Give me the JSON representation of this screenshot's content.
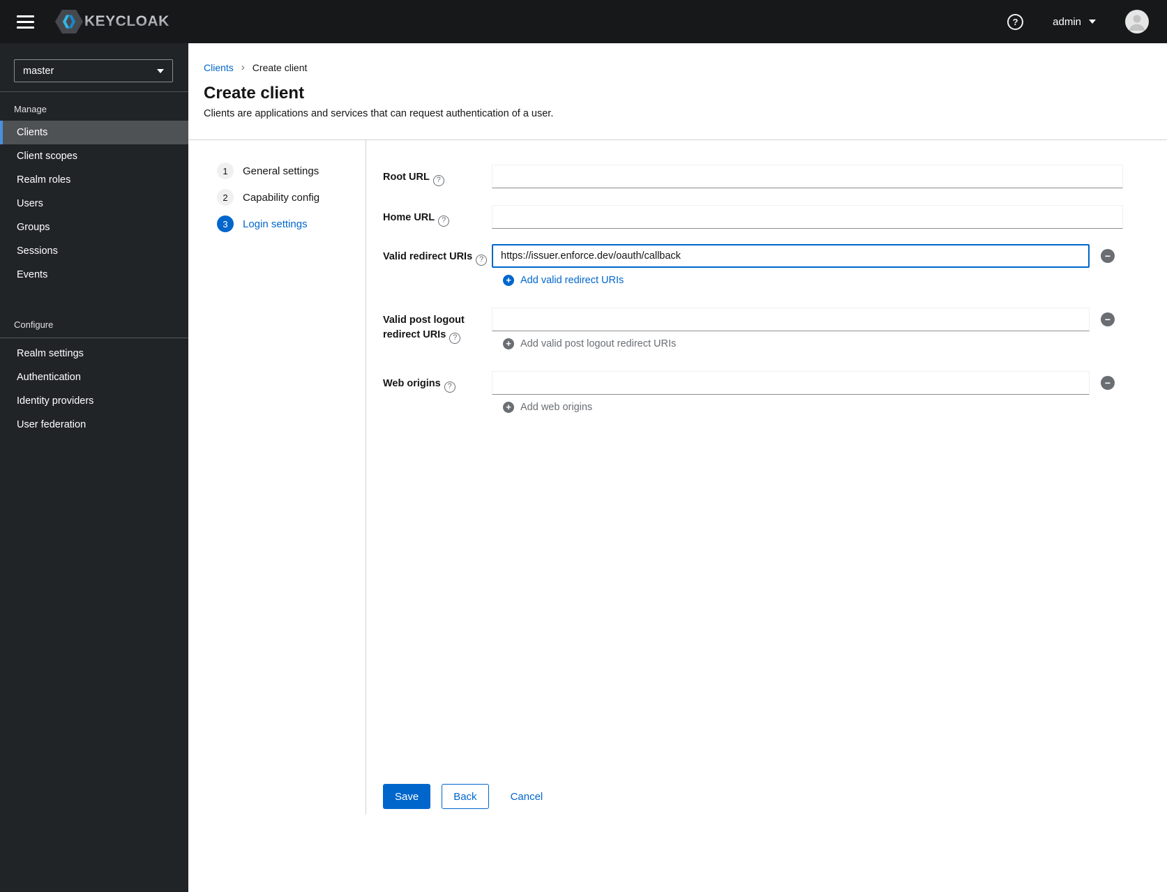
{
  "topbar": {
    "brand": "KEYCLOAK",
    "user": "admin"
  },
  "icons": {
    "question": "?",
    "plus": "+",
    "minus": "−",
    "breadcrumb_separator": "›"
  },
  "sidebar": {
    "realm": "master",
    "groups": [
      {
        "label": "Manage",
        "items": [
          "Clients",
          "Client scopes",
          "Realm roles",
          "Users",
          "Groups",
          "Sessions",
          "Events"
        ],
        "selected": "Clients"
      },
      {
        "label": "Configure",
        "items": [
          "Realm settings",
          "Authentication",
          "Identity providers",
          "User federation"
        ]
      }
    ]
  },
  "breadcrumb": {
    "items": [
      "Clients",
      "Create client"
    ]
  },
  "page": {
    "title": "Create client",
    "description": "Clients are applications and services that can request authentication of a user."
  },
  "wizard": {
    "steps": [
      {
        "num": "1",
        "label": "General settings"
      },
      {
        "num": "2",
        "label": "Capability config"
      },
      {
        "num": "3",
        "label": "Login settings",
        "active": true
      }
    ]
  },
  "form": {
    "root_url": {
      "label": "Root URL",
      "value": ""
    },
    "home_url": {
      "label": "Home URL",
      "value": ""
    },
    "redirect_uris": {
      "label": "Valid redirect URIs",
      "value": "https://issuer.enforce.dev/oauth/callback",
      "add_label": "Add valid redirect URIs"
    },
    "post_logout_uris": {
      "label": "Valid post logout redirect URIs",
      "value": "",
      "add_label": "Add valid post logout redirect URIs"
    },
    "web_origins": {
      "label": "Web origins",
      "value": "",
      "add_label": "Add web origins"
    }
  },
  "actions": {
    "save": "Save",
    "back": "Back",
    "cancel": "Cancel"
  },
  "colors": {
    "accent": "#0066cc",
    "nav_selected": "#4f5255",
    "nav_selected_border": "#4a90dd",
    "disabled_text": "#6a6e73"
  }
}
